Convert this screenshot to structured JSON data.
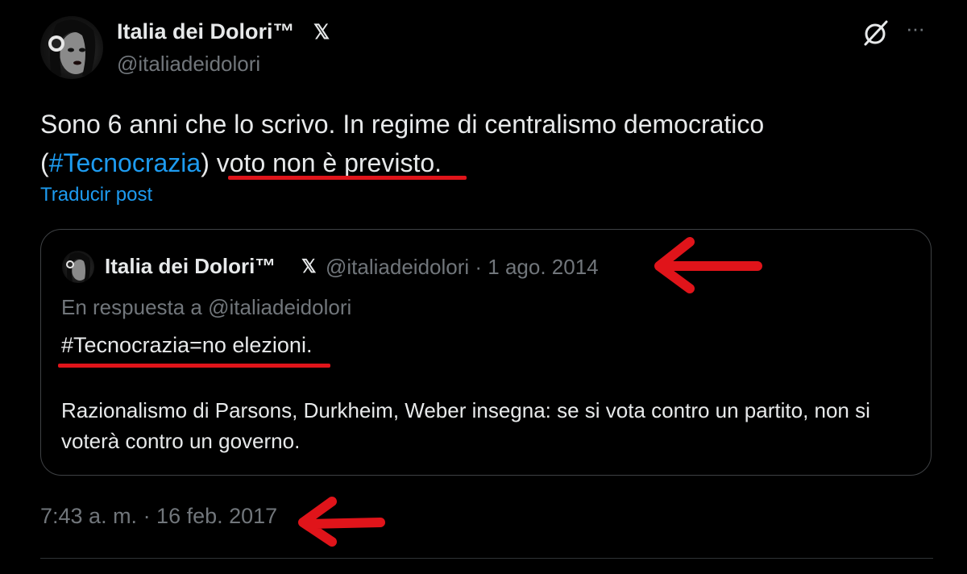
{
  "author": {
    "name": "Italia dei Dolori™",
    "verified_glyph": "𝕏",
    "handle": "@italiadeidolori"
  },
  "header_icons": [
    "grok-icon",
    "more-icon"
  ],
  "more_glyph": "···",
  "tweet": {
    "line1": "Sono 6 anni che lo scrivo. In regime di centralismo democratico",
    "open_paren": "(",
    "hashtag": "#Tecnocrazia",
    "close_paren": ") ",
    "underlined": "voto non è previsto",
    "period": "."
  },
  "translate_label": "Traducir post",
  "quoted": {
    "name": "Italia dei Dolori™",
    "verified_glyph": "𝕏",
    "handle_date": "@italiadeidolori · 1 ago. 2014",
    "reply_to": "En respuesta a @italiadeidolori",
    "line1": "#Tecnocrazia=no elezioni.",
    "body": "Razionalismo di Parsons, Durkheim, Weber insegna: se si vota contro un partito, non si voterà contro un governo."
  },
  "timestamp": "7:43 a. m. · 16 feb. 2017",
  "colors": {
    "background": "#000000",
    "text": "#e7e9ea",
    "muted": "#71767b",
    "link": "#1d9bf0",
    "annotation_red": "#e0141a",
    "border": "#3e4144"
  }
}
